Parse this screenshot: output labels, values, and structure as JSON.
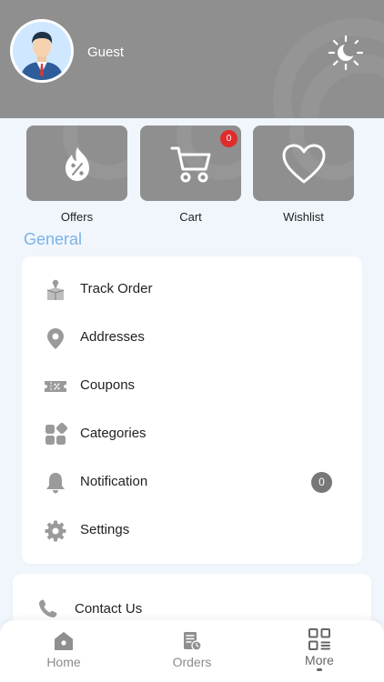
{
  "header": {
    "user_name": "Guest",
    "theme_icon": "sun-icon",
    "colors": {
      "header_bg": "#8f8f8f",
      "accent": "#7ab3e6",
      "badge": "#e02b2b"
    }
  },
  "quick_tiles": [
    {
      "label": "Offers",
      "icon": "discount-flame-icon"
    },
    {
      "label": "Cart",
      "icon": "cart-icon",
      "badge": "0"
    },
    {
      "label": "Wishlist",
      "icon": "heart-icon"
    }
  ],
  "section": {
    "title": "General"
  },
  "menu": [
    {
      "label": "Track Order",
      "icon": "location-box-icon"
    },
    {
      "label": "Addresses",
      "icon": "location-pin-icon"
    },
    {
      "label": "Coupons",
      "icon": "ticket-icon"
    },
    {
      "label": "Categories",
      "icon": "categories-icon"
    },
    {
      "label": "Notification",
      "icon": "bell-icon",
      "count": "0"
    },
    {
      "label": "Settings",
      "icon": "gear-icon"
    }
  ],
  "contact": {
    "label": "Contact Us",
    "icon": "phone-icon"
  },
  "bottom_nav": [
    {
      "label": "Home",
      "icon": "home-icon"
    },
    {
      "label": "Orders",
      "icon": "orders-icon"
    },
    {
      "label": "More",
      "icon": "more-grid-icon",
      "active": true
    }
  ]
}
